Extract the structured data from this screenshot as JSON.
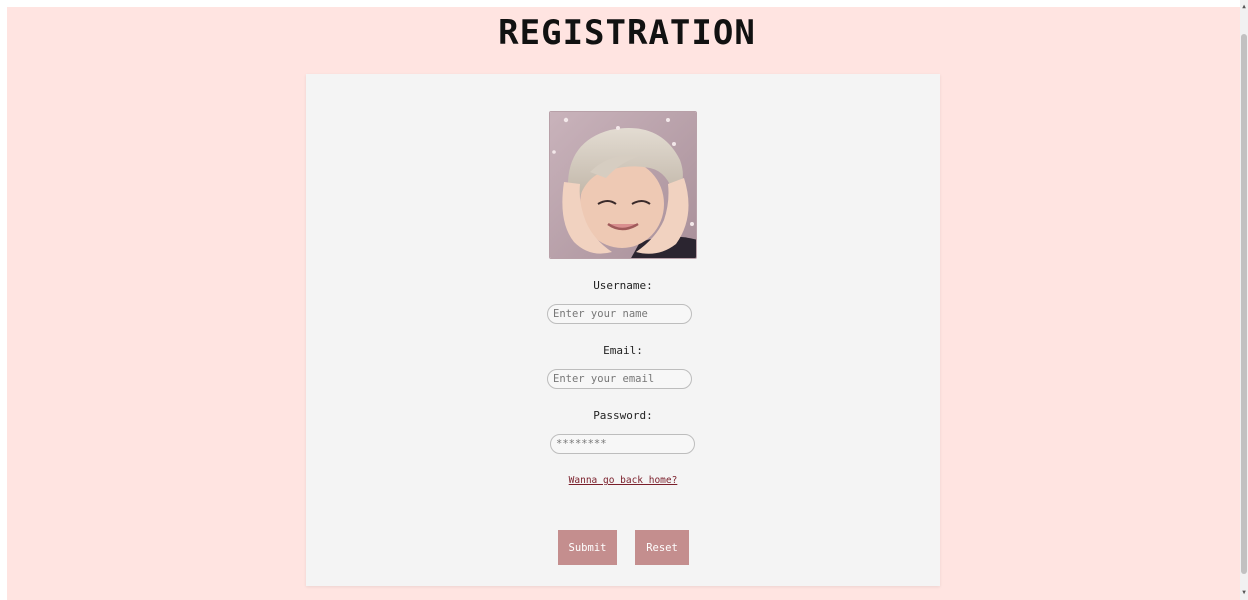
{
  "page": {
    "title": "REGISTRATION"
  },
  "form": {
    "username_label": "Username:",
    "username_placeholder": "Enter your name",
    "email_label": "Email:",
    "email_placeholder": "Enter your email",
    "password_label": "Password:",
    "password_placeholder": "********",
    "home_link": "Wanna go back home?",
    "submit_label": "Submit",
    "reset_label": "Reset"
  },
  "colors": {
    "page_background": "#ffe4e1",
    "card_background": "#f4f4f4",
    "button_background": "#c48e8e",
    "link_color": "#7a1e2a"
  },
  "icons": {
    "scroll_up": "scroll-up-arrow-icon",
    "scroll_down": "scroll-down-arrow-icon"
  }
}
